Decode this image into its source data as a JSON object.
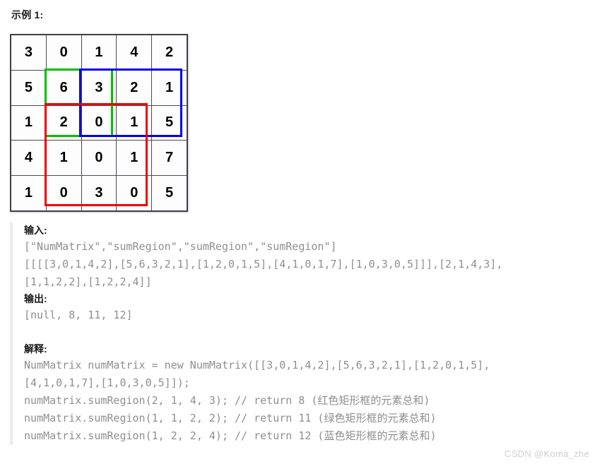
{
  "example_title": "示例 1:",
  "matrix": {
    "rows": 5,
    "cols": 5,
    "values": [
      [
        3,
        0,
        1,
        4,
        2
      ],
      [
        5,
        6,
        3,
        2,
        1
      ],
      [
        1,
        2,
        0,
        1,
        5
      ],
      [
        4,
        1,
        0,
        1,
        7
      ],
      [
        1,
        0,
        3,
        0,
        5
      ]
    ],
    "highlights": [
      {
        "name": "green-rect",
        "color": "#00c000",
        "row1": 1,
        "col1": 1,
        "row2": 2,
        "col2": 2,
        "sum": 11,
        "label": "绿色矩形框"
      },
      {
        "name": "blue-rect",
        "color": "#0000f0",
        "row1": 1,
        "col1": 2,
        "row2": 2,
        "col2": 4,
        "sum": 12,
        "label": "蓝色矩形框"
      },
      {
        "name": "red-rect",
        "color": "#ee0000",
        "row1": 2,
        "col1": 1,
        "row2": 4,
        "col2": 3,
        "sum": 8,
        "label": "红色矩形框"
      }
    ]
  },
  "input": {
    "heading": "输入:",
    "lines": [
      "[\"NumMatrix\",\"sumRegion\",\"sumRegion\",\"sumRegion\"]",
      "[[[[3,0,1,4,2],[5,6,3,2,1],[1,2,0,1,5],[4,1,0,1,7],[1,0,3,0,5]]],[2,1,4,3],",
      "[1,1,2,2],[1,2,2,4]]"
    ]
  },
  "output": {
    "heading": "输出:",
    "lines": [
      "[null, 8, 11, 12]"
    ]
  },
  "explanation": {
    "heading": "解释:",
    "lines": [
      "NumMatrix numMatrix = new NumMatrix([[3,0,1,4,2],[5,6,3,2,1],[1,2,0,1,5],",
      "[4,1,0,1,7],[1,0,3,0,5]]);",
      "numMatrix.sumRegion(2, 1, 4, 3); // return 8 (红色矩形框的元素总和)",
      "numMatrix.sumRegion(1, 1, 2, 2); // return 11 (绿色矩形框的元素总和)",
      "numMatrix.sumRegion(1, 2, 2, 4); // return 12 (蓝色矩形框的元素总和)"
    ]
  },
  "watermark": "CSDN @Koma_zhe"
}
